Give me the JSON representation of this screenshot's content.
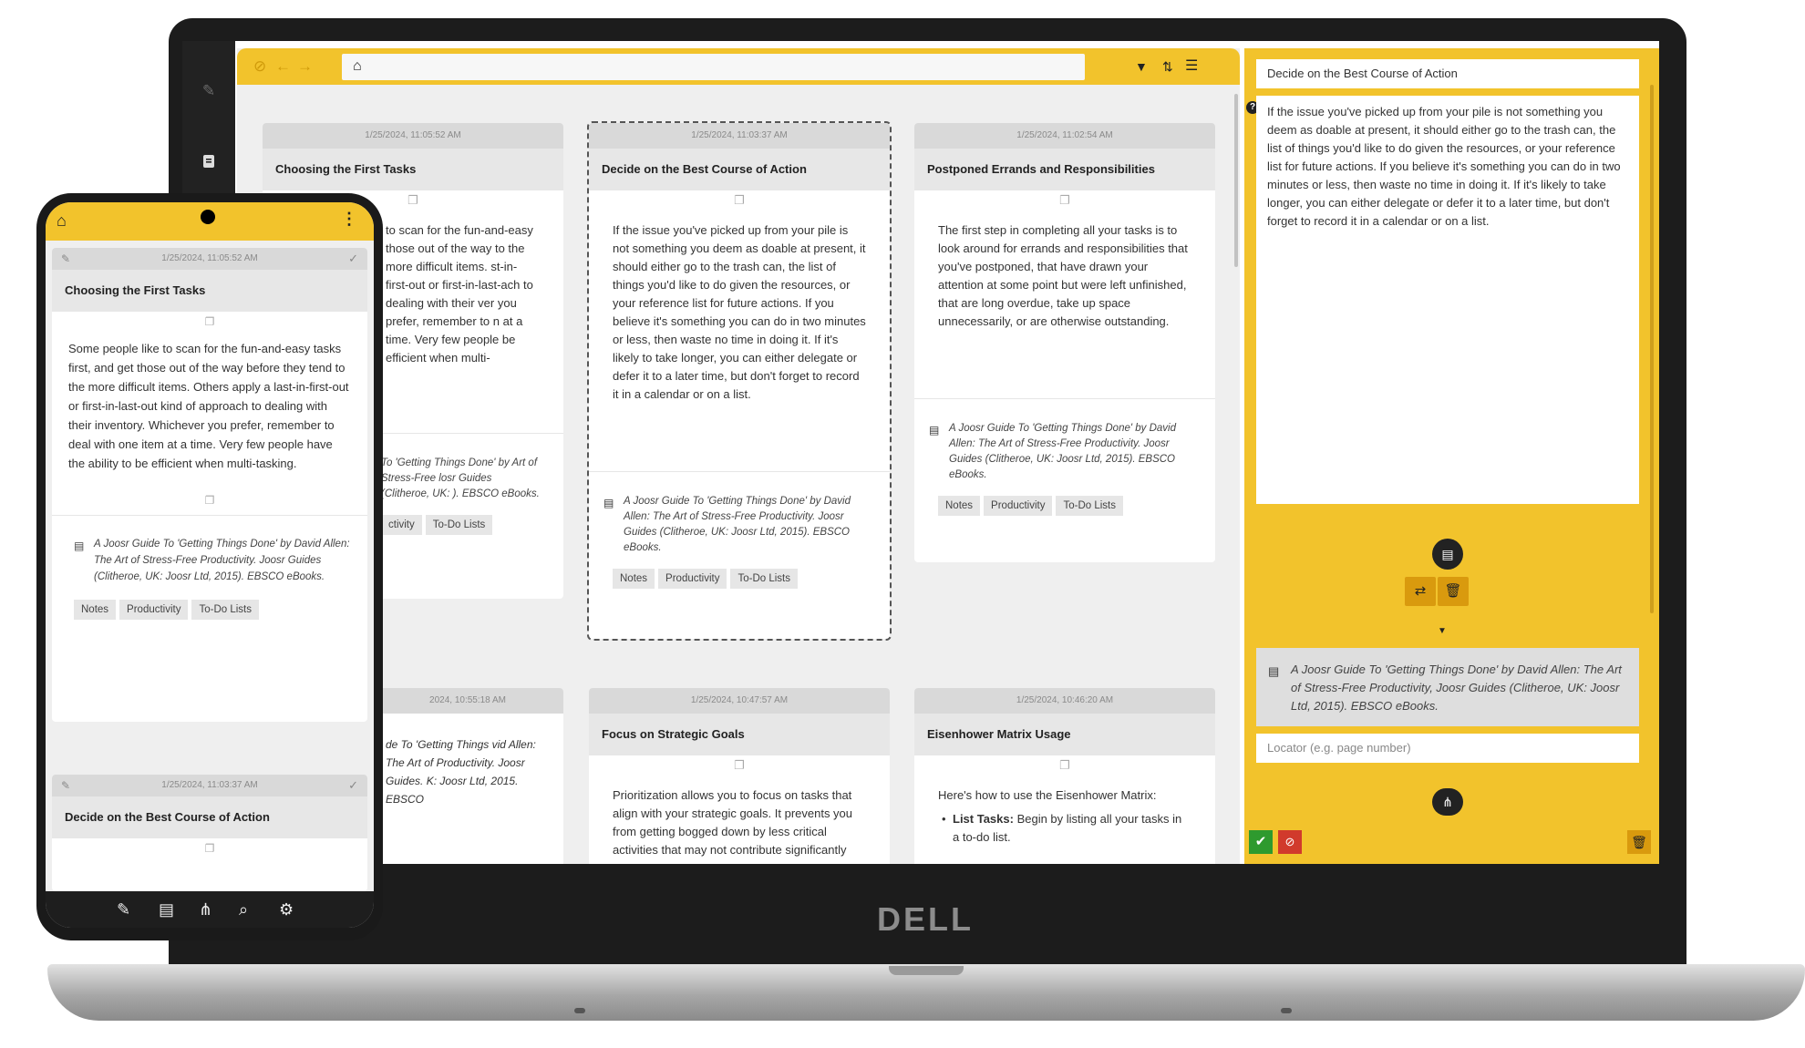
{
  "brand": {
    "logo": "DELL"
  },
  "colors": {
    "accent": "#f2c32c",
    "accent_dark": "#d99a0e",
    "ok": "#2e9a2e",
    "cancel": "#d13a2c"
  },
  "laptop": {
    "rail": {
      "icons": [
        "pencil-icon",
        "book-icon"
      ]
    },
    "toolbar": {
      "icons": [
        "cancel-icon",
        "back-icon",
        "forward-icon",
        "home-icon",
        "filter-icon",
        "sort-icon",
        "menu-icon"
      ]
    },
    "cards": [
      {
        "date": "1/25/2024, 11:05:52 AM",
        "title": "Choosing the First Tasks",
        "body": "to scan for the fun-and-easy those out of the way to the more difficult items. st-in-first-out or first-in-last-ach to dealing with their ver you prefer, remember to n at a time. Very few people be efficient when multi-",
        "source": "To 'Getting Things Done' by Art of Stress-Free losr Guides (Clitheroe, UK: ). EBSCO eBooks.",
        "tags": [
          "ctivity",
          "To-Do Lists"
        ]
      },
      {
        "date": "1/25/2024, 11:03:37 AM",
        "title": "Decide on the Best Course of Action",
        "body": "If the issue you've picked up from your pile is not something you deem as doable at present, it should either go to the trash can, the list of things you'd like to do given the resources, or your reference list for future actions. If you believe it's something you can do in two minutes or less, then waste no time in doing it. If it's likely to take longer, you can either delegate or defer it to a later time, but don't forget to record it in a calendar or on a list.",
        "source": "A Joosr Guide To 'Getting Things Done' by David Allen: The Art of Stress-Free Productivity. Joosr Guides (Clitheroe, UK: Joosr Ltd, 2015). EBSCO eBooks.",
        "tags": [
          "Notes",
          "Productivity",
          "To-Do Lists"
        ]
      },
      {
        "date": "1/25/2024, 11:02:54 AM",
        "title": "Postponed Errands and Responsibilities",
        "body": "The first step in completing all your tasks is to look around for errands and responsibilities that you've postponed, that have drawn your attention at some point but were left unfinished, that are long overdue, take up space unnecessarily, or are otherwise outstanding.",
        "source": "A Joosr Guide To 'Getting Things Done' by David Allen: The Art of Stress-Free Productivity. Joosr Guides (Clitheroe, UK: Joosr Ltd, 2015). EBSCO eBooks.",
        "tags": [
          "Notes",
          "Productivity",
          "To-Do Lists"
        ]
      },
      {
        "date": "2024, 10:55:18 AM",
        "title": "",
        "body": "de To 'Getting Things vid Allen: The Art of Productivity. Joosr Guides. K: Joosr Ltd, 2015. EBSCO"
      },
      {
        "date": "1/25/2024, 10:47:57 AM",
        "title": "Focus on Strategic Goals",
        "body": "Prioritization allows you to focus on tasks that align with your strategic goals. It prevents you from getting bogged down by less critical activities that may not contribute significantly"
      },
      {
        "date": "1/25/2024, 10:46:20 AM",
        "title": "Eisenhower Matrix Usage",
        "body": "Here's how to use the Eisenhower Matrix:",
        "list_label": "List Tasks:",
        "list_text": " Begin by listing all your tasks in a to-do list."
      }
    ],
    "editor": {
      "title": "Decide on the Best Course of Action",
      "text": "If the issue you've picked up from your pile is not something you deem as doable at present, it should either go to the trash can, the list of things you'd like to do given the resources, or your reference list for future actions. If you believe it's something you can do in two minutes or less, then waste no time in doing it. If it's likely to take longer, you can either delegate or defer it to a later time, but don't forget to record it in a calendar or on a list.",
      "source": "A Joosr Guide To 'Getting Things Done' by David Allen: The Art of Stress-Free Productivity, Joosr Guides (Clitheroe, UK: Joosr Ltd, 2015). EBSCO eBooks.",
      "locator_placeholder": "Locator (e.g. page number)"
    }
  },
  "phone": {
    "cards": [
      {
        "date": "1/25/2024, 11:05:52 AM",
        "title": "Choosing the First Tasks",
        "body": "Some people like to scan for the fun-and-easy tasks first, and get those out of the way before they tend to the more difficult items. Others apply a last-in-first-out or first-in-last-out kind of approach to dealing with their inventory. Whichever you prefer, remember to deal with one item at a time. Very few people have the ability to be efficient when multi-tasking.",
        "source": "A Joosr Guide To 'Getting Things Done' by David Allen: The Art of Stress-Free Productivity. Joosr Guides (Clitheroe, UK: Joosr Ltd, 2015). EBSCO eBooks.",
        "tags": [
          "Notes",
          "Productivity",
          "To-Do Lists"
        ]
      },
      {
        "date": "1/25/2024, 11:03:37 AM",
        "title": "Decide on the Best Course of Action"
      }
    ],
    "nav_icons": [
      "pencil-icon",
      "book-icon",
      "sitemap-icon",
      "search-icon",
      "gear-icon"
    ]
  }
}
